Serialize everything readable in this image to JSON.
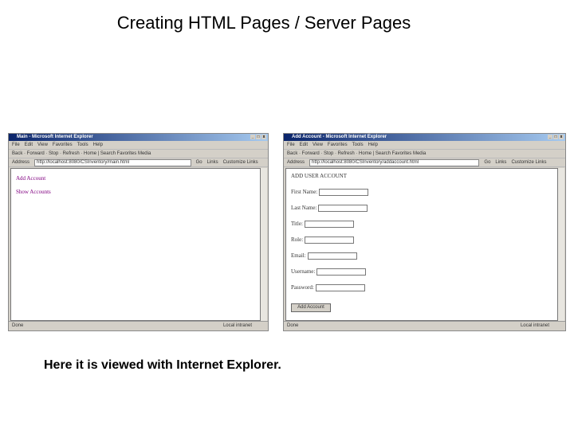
{
  "slide": {
    "title": "Creating HTML Pages / Server Pages",
    "caption": "Here it is viewed with Internet Explorer."
  },
  "browser": {
    "menu": [
      "File",
      "Edit",
      "View",
      "Favorites",
      "Tools",
      "Help"
    ],
    "toolbar": "Back · Forward · Stop · Refresh · Home | Search  Favorites  Media",
    "address_label": "Address",
    "go": "Go",
    "links": "Links",
    "customize": "Customize Links",
    "status_done": "Done",
    "zone": "Local intranet"
  },
  "left": {
    "window_title": "Main - Microsoft Internet Explorer",
    "url": "http://localhost:8080/CSInventory/main.html",
    "links": [
      "Add Account",
      "Show Accounts"
    ]
  },
  "right": {
    "window_title": "Add Account - Microsoft Internet Explorer",
    "url": "http://localhost:8080/CSInventory/addaccount.html",
    "heading": "ADD USER ACCOUNT",
    "fields": [
      "First Name:",
      "Last Name:",
      "Title:",
      "Role:",
      "Email:",
      "Username:",
      "Password:"
    ],
    "submit": "Add Account"
  }
}
